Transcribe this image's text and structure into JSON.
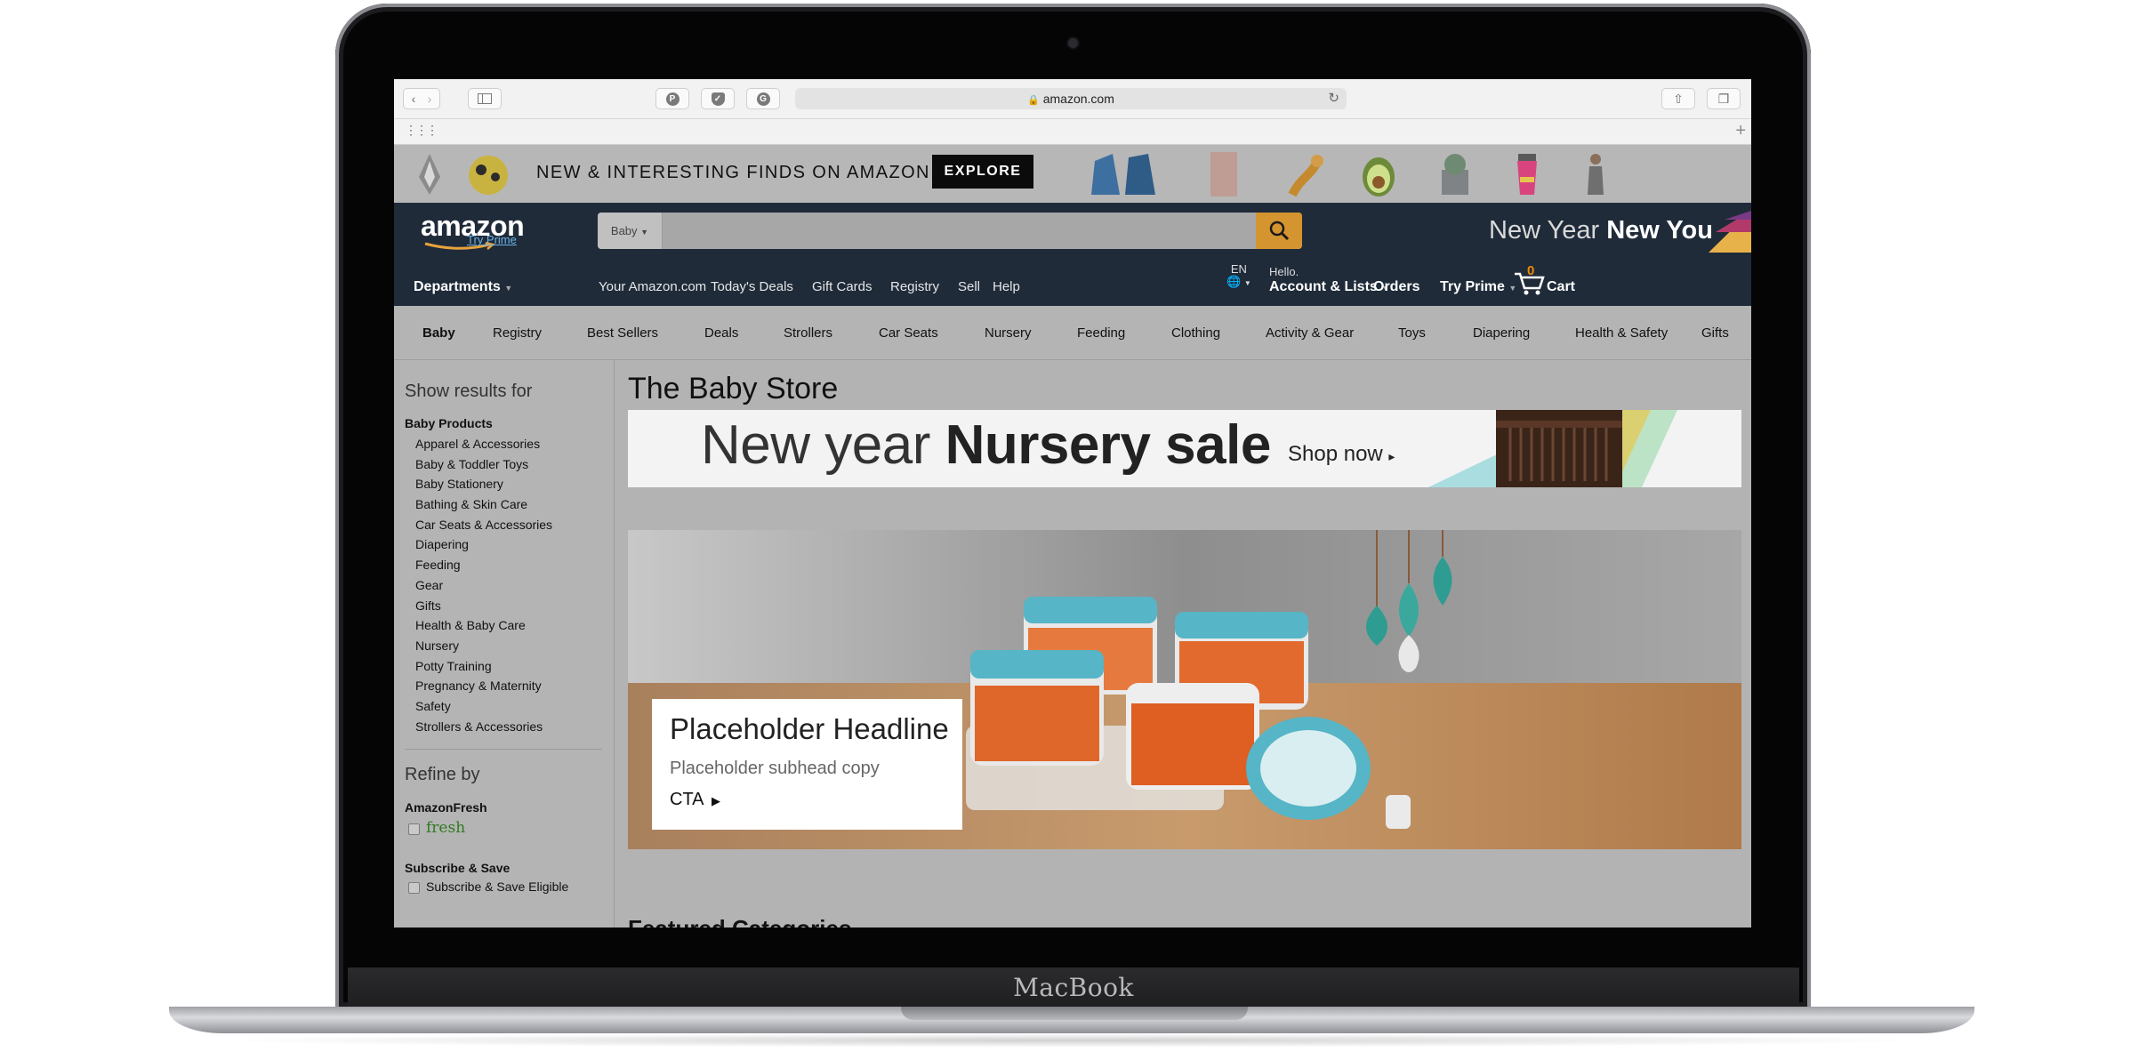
{
  "device": {
    "label": "MacBook"
  },
  "browser": {
    "url": "amazon.com",
    "back_icon": "chevron-left-icon",
    "forward_icon": "chevron-right-icon",
    "sidebar_icon": "sidebar-icon",
    "pinterest_icon": "pinterest-icon",
    "pocket_icon": "pocket-icon",
    "grammarly_icon": "grammarly-icon",
    "reload_icon": "reload-icon",
    "share_icon": "share-icon",
    "tabs_icon": "tabs-icon",
    "new_tab_icon": "plus-icon",
    "top_sites_icon": "grid-icon"
  },
  "promo": {
    "text_bold": "NEW & INTERESTING FINDS",
    "text_light": " ON AMAZON",
    "explore_label": "EXPLORE"
  },
  "nav": {
    "logo": "amazon",
    "try_prime_small": "Try Prime",
    "search_dept": "Baby",
    "search_value": "",
    "banner_light": "New Year ",
    "banner_bold": "New You",
    "departments": "Departments",
    "links": [
      "Your Amazon.com",
      "Today's Deals",
      "Gift Cards",
      "Registry",
      "Sell",
      "Help"
    ],
    "lang": "EN",
    "hello": "Hello.",
    "account_lists": "Account & Lists",
    "orders": "Orders",
    "try_prime": "Try Prime",
    "cart_count": "0",
    "cart_label": "Cart"
  },
  "subnav": [
    "Baby",
    "Registry",
    "Best Sellers",
    "Deals",
    "Strollers",
    "Car Seats",
    "Nursery",
    "Feeding",
    "Clothing",
    "Activity & Gear",
    "Toys",
    "Diapering",
    "Health & Safety",
    "Gifts"
  ],
  "sidebar": {
    "show_results_for": "Show results for",
    "category_head": "Baby Products",
    "categories": [
      "Apparel & Accessories",
      "Baby & Toddler Toys",
      "Baby Stationery",
      "Bathing & Skin Care",
      "Car Seats & Accessories",
      "Diapering",
      "Feeding",
      "Gear",
      "Gifts",
      "Health & Baby Care",
      "Nursery",
      "Potty Training",
      "Pregnancy & Maternity",
      "Safety",
      "Strollers & Accessories"
    ],
    "refine_by": "Refine by",
    "amazonfresh_head": "AmazonFresh",
    "fresh_label": "fresh",
    "subscribe_head": "Subscribe & Save",
    "subscribe_label": "Subscribe & Save Eligible"
  },
  "main": {
    "store_title": "The Baby Store",
    "banner_light": "New year ",
    "banner_bold": "Nursery sale",
    "banner_cta": "Shop now",
    "hero_headline": "Placeholder Headline",
    "hero_subhead": "Placeholder subhead copy",
    "hero_cta": "CTA",
    "featured_heading": "Featured Categories"
  },
  "colors": {
    "nav_bg": "#1f2b39",
    "search_button": "#d4942f",
    "cart_count": "#f08804",
    "try_prime_link": "#6ab4e9",
    "fresh_green": "#2f7a1f"
  }
}
